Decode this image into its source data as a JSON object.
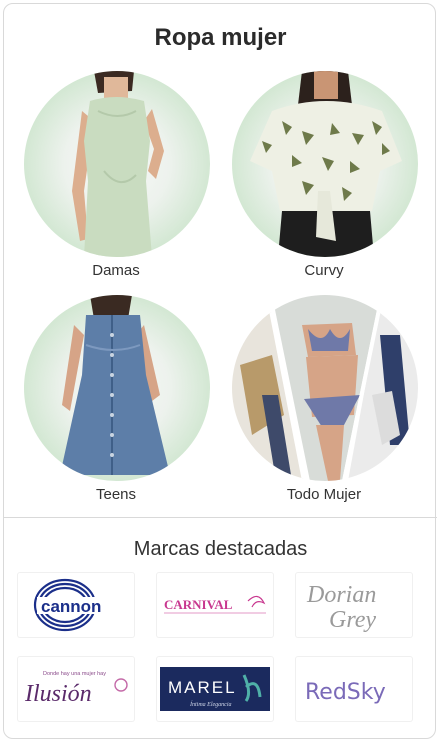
{
  "section": {
    "title": "Ropa mujer"
  },
  "categories": [
    {
      "label": "Damas",
      "image": "woman-green-dress-photo"
    },
    {
      "label": "Curvy",
      "image": "woman-printed-blouse-photo"
    },
    {
      "label": "Teens",
      "image": "girl-denim-dress-photo"
    },
    {
      "label": "Todo Mujer",
      "image": "collage-lingerie-photo"
    }
  ],
  "brands": {
    "title": "Marcas destacadas",
    "items": [
      {
        "name": "cannon",
        "logo_text": "cannon",
        "color": "#1b2f8a"
      },
      {
        "name": "carnival",
        "logo_text": "CARNIVAL",
        "color": "#c8378f"
      },
      {
        "name": "dorian-grey",
        "logo_text_1": "Dorian",
        "logo_text_2": "Grey",
        "color": "#9a9a9a"
      },
      {
        "name": "ilusion",
        "logo_text": "Ilusión",
        "tagline": "Donde hay una mujer hay",
        "color": "#5a2a6a"
      },
      {
        "name": "marel",
        "logo_text": "MAREL",
        "tagline": "Íntima Elegancia",
        "color": "#1b2a5e"
      },
      {
        "name": "redsky",
        "logo_text": "RedSky",
        "color": "#7a6ab8"
      }
    ]
  }
}
